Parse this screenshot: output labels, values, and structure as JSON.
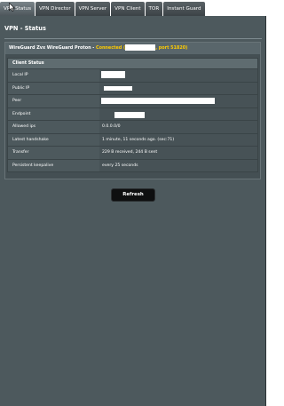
{
  "tabs": [
    {
      "label": "VPN Status"
    },
    {
      "label": "VPN Director"
    },
    {
      "label": "VPN Server"
    },
    {
      "label": "VPN Client"
    },
    {
      "label": "TOR"
    },
    {
      "label": "Instant Guard"
    }
  ],
  "page": {
    "title": "VPN - Status"
  },
  "panel": {
    "name": "WireGuard Zvx WireGuard Proton",
    "separator": " - ",
    "status": "Connected",
    "open_bracket": " (",
    "port_text": ", port 51820)"
  },
  "client_status": {
    "heading": "Client Status",
    "rows": [
      {
        "label": "Local IP",
        "value": ""
      },
      {
        "label": "Public IP",
        "value": ""
      },
      {
        "label": "Peer",
        "value": ""
      },
      {
        "label": "Endpoint",
        "value": ""
      },
      {
        "label": "Allowed ips",
        "value": "0.0.0.0/0"
      },
      {
        "label": "Latest handshake",
        "value": "1 minute, 11 seconds ago. (sec:71)"
      },
      {
        "label": "Transfer",
        "value": "229 B received, 244 B sent"
      },
      {
        "label": "Persistent keepalive",
        "value": "every 25 seconds"
      }
    ]
  },
  "actions": {
    "refresh_label": "Refresh"
  },
  "colors": {
    "background": "#4d595d",
    "status_connected": "#ffcc00"
  },
  "icons": {
    "cursor": "mouse-pointer-icon"
  }
}
